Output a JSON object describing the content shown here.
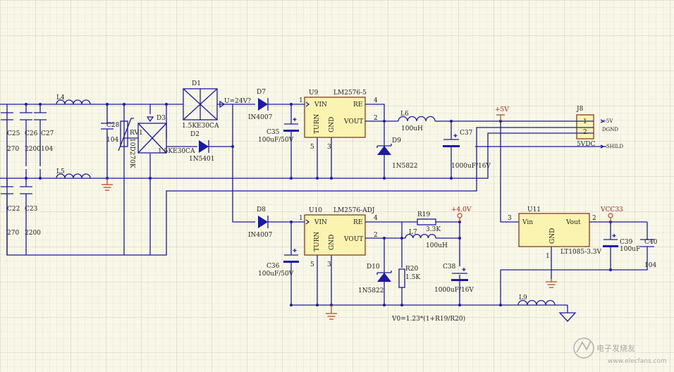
{
  "diagram": {
    "u9": {
      "designator": "U9",
      "part": "LM2576-5",
      "pin_vin": "VIN",
      "pin_re": "RE",
      "pin_vout": "VOUT",
      "pin_turn": "TURN",
      "pin_gnd": "GND",
      "n1": "1",
      "n4": "4",
      "n2": "2",
      "n5": "5",
      "n3": "3"
    },
    "u10": {
      "designator": "U10",
      "part": "LM2576-ADJ",
      "pin_vin": "VIN",
      "pin_re": "RE",
      "pin_vout": "VOUT",
      "pin_turn": "TURN",
      "pin_gnd": "GND",
      "n1": "1",
      "n4": "4",
      "n2": "2",
      "n5": "5",
      "n3": "3"
    },
    "u11": {
      "designator": "U11",
      "part": "LT1085-3.3V",
      "pin_vin": "Vin",
      "pin_vout": "Vout",
      "pin_gnd": "GND",
      "n3": "3",
      "n2": "2",
      "n1": "1"
    },
    "j8": {
      "designator": "J8",
      "value": "5VDC",
      "pin1": "1",
      "pin2": "2",
      "sig1": "+5V",
      "sig2": "DGND",
      "sig3": "SHILD"
    },
    "nets": {
      "u_in": "U=24V?",
      "p5v": "+5V",
      "p4v": "+4.0V",
      "vcc33": "VCC33"
    },
    "parts": {
      "d1": "D1",
      "d1_val": "1.5KE30CA",
      "d2": "D2",
      "d2_val": "1N5401",
      "d3": "D3",
      "d3_val": "1.5KE30CA",
      "d7": "D7",
      "d7_val": "IN4007",
      "d8": "D8",
      "d8_val": "IN4007",
      "d9": "D9",
      "d9_val": "1N5822",
      "d10": "D10",
      "d10_val": "1N5822",
      "l4": "L4",
      "l5": "L5",
      "l6": "L6",
      "l6_val": "100uH",
      "l7": "L7",
      "l7_val": "100uH",
      "l9": "L9",
      "rv1": "RV1",
      "rv1_val": "10D270K",
      "r19": "R19",
      "r19_val": "3.3K",
      "r20": "R20",
      "r20_val": "1.5K",
      "c25": "C25",
      "c25_val": "270",
      "c26": "C26",
      "c26_val": "2200",
      "c27": "C27",
      "c27_val": "104",
      "c22": "C22",
      "c22_val": "270",
      "c23": "C23",
      "c23_val": "2200",
      "c28": "C28",
      "c28_val": "104",
      "c35": "C35",
      "c35_val": "100uF/50V",
      "c36": "C36",
      "c36_val": "100uF/50V",
      "c37": "C37",
      "c37_val": "1000uF/16V",
      "c38": "C38",
      "c38_val": "1000uF/16V",
      "c39": "C39",
      "c39_val": "100uF",
      "c40": "C40",
      "c40_val": "104"
    },
    "formula": "V0=1.23*(1+R19/R20)",
    "watermark": "电子发烧友",
    "watermark_url": "www.elecfans.com"
  },
  "colors": {
    "wire": "#1a1aa6",
    "ic_fill": "#fbf3b0",
    "ic_border": "#7a3010",
    "net_label": "#b8201a",
    "grid": "#d2d2c0",
    "background": "#f8f7e8"
  }
}
